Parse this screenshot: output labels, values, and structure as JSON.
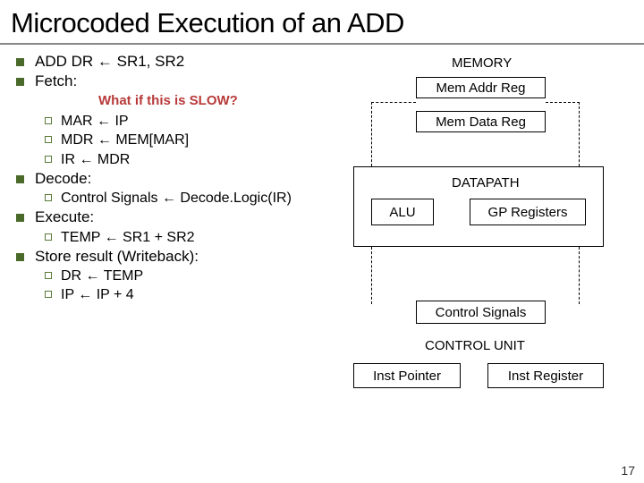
{
  "title": "Microcoded Execution of an ADD",
  "left": {
    "line1": "ADD DR ← SR1, SR2",
    "fetch_label": "Fetch:",
    "annotation": "What if this is SLOW?",
    "fetch_items": [
      "MAR ← IP",
      "MDR ← MEM[MAR]",
      "IR ← MDR"
    ],
    "decode_label": "Decode:",
    "decode_items": [
      "Control Signals ← Decode.Logic(IR)"
    ],
    "execute_label": "Execute:",
    "execute_items": [
      "TEMP ← SR1 + SR2"
    ],
    "store_label": "Store result (Writeback):",
    "store_items": [
      "DR ← TEMP",
      "IP ← IP + 4"
    ]
  },
  "diagram": {
    "memory_label": "MEMORY",
    "mem_addr": "Mem Addr Reg",
    "mem_data": "Mem Data Reg",
    "datapath_label": "DATAPATH",
    "alu": "ALU",
    "gpreg": "GP Registers",
    "ctrl_signals": "Control Signals",
    "control_unit_label": "CONTROL UNIT",
    "inst_ptr": "Inst Pointer",
    "inst_reg": "Inst Register"
  },
  "page_number": "17"
}
